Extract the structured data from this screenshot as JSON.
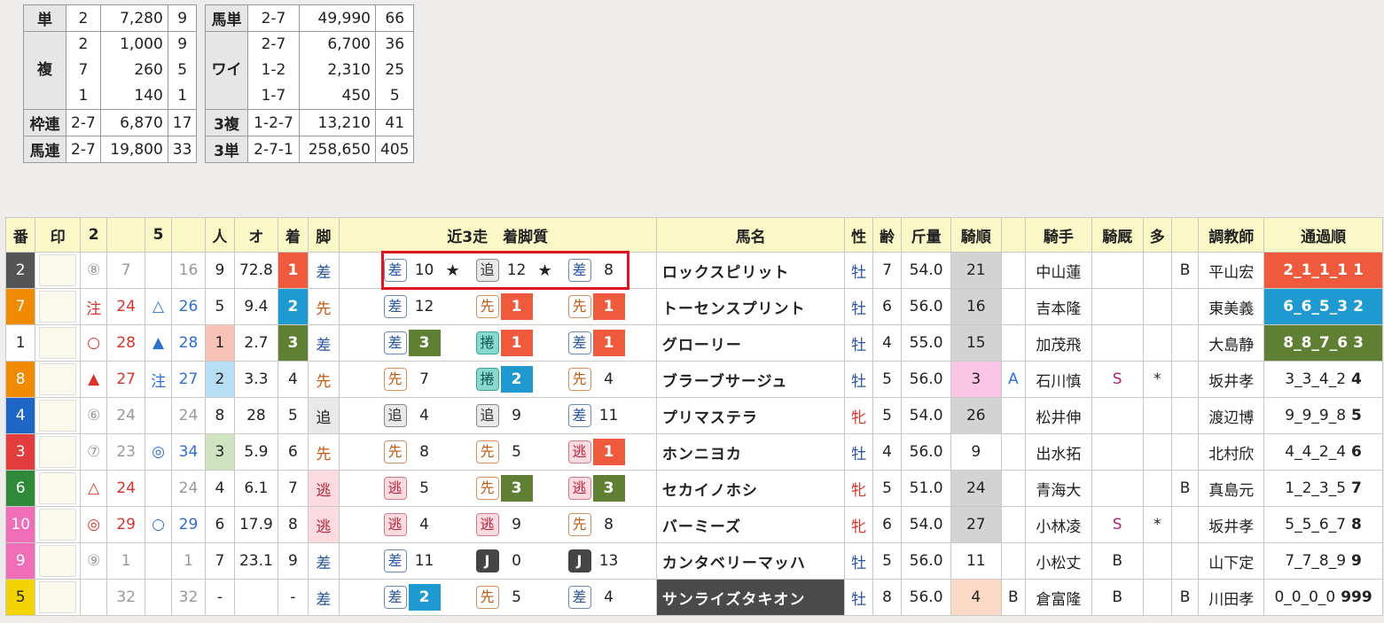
{
  "payout_left": {
    "tan": {
      "label": "単",
      "horse": "2",
      "amount": "7,280",
      "pop": "9"
    },
    "fuku": {
      "label": "複",
      "rows": [
        {
          "horse": "2",
          "amount": "1,000",
          "pop": "9"
        },
        {
          "horse": "7",
          "amount": "260",
          "pop": "5"
        },
        {
          "horse": "1",
          "amount": "140",
          "pop": "1"
        }
      ]
    },
    "wakuren": {
      "label": "枠連",
      "horse": "2-7",
      "amount": "6,870",
      "pop": "17"
    },
    "umaren": {
      "label": "馬連",
      "horse": "2-7",
      "amount": "19,800",
      "pop": "33"
    }
  },
  "payout_right": {
    "umatan": {
      "label": "馬単",
      "horse": "2-7",
      "amount": "49,990",
      "pop": "66"
    },
    "wide": {
      "label": "ワイ",
      "rows": [
        {
          "horse": "2-7",
          "amount": "6,700",
          "pop": "36"
        },
        {
          "horse": "1-2",
          "amount": "2,310",
          "pop": "25"
        },
        {
          "horse": "1-7",
          "amount": "450",
          "pop": "5"
        }
      ]
    },
    "sanfuku": {
      "label": "3複",
      "horse": "1-2-7",
      "amount": "13,210",
      "pop": "41"
    },
    "santan": {
      "label": "3単",
      "horse": "2-7-1",
      "amount": "258,650",
      "pop": "405"
    }
  },
  "headers": {
    "ban": "番",
    "shirushi": "印",
    "c2": "2",
    "c2b": "",
    "c5": "5",
    "c5b": "",
    "ninki": "人",
    "odds": "オ",
    "chaku": "着",
    "kyaku": "脚",
    "recent": "近3走　着脚質",
    "name": "馬名",
    "sex": "性",
    "age": "齢",
    "kinryo": "斤量",
    "kijun": "騎順",
    "k_blank": "",
    "jockey": "騎手",
    "kikyu": "騎厩",
    "ta": "多",
    "t_blank": "",
    "trainer": "調教師",
    "passing": "通過順"
  },
  "colors": {
    "frame": {
      "1": "#ffffff",
      "2": "#555555",
      "3": "#e23c3c",
      "4": "#1f66c6",
      "5": "#f3d400",
      "6": "#2f8a3a",
      "7": "#f08a00",
      "8": "#f08a00",
      "9": "#f06db8",
      "10": "#f06db8"
    },
    "place": {
      "1": "#f05a3c",
      "2": "#1f9ad0",
      "3": "#5f7f33"
    },
    "pop": {
      "1": "#f9c2b6",
      "2": "#b7def2",
      "3": "#cfe3c0"
    },
    "kijun_gray": "#d3d3d3",
    "kijun_pink": "#fbc6e6",
    "kijun_peach": "#fbd9c6",
    "pass": {
      "1": "#f05a3c",
      "2": "#1f9ad0",
      "3": "#5f7f33"
    }
  },
  "rows": [
    {
      "ban": "2",
      "frame": "2",
      "c2": "⑧",
      "c2v": "7",
      "c5": "",
      "c5v": "16",
      "ninki": "9",
      "odds": "72.8",
      "chaku": "1",
      "kyaku": "差",
      "recent": [
        {
          "s": "差",
          "p": "10",
          "star": "★"
        },
        {
          "s": "追",
          "p": "12",
          "star": "★"
        },
        {
          "s": "差",
          "p": "8",
          "star": ""
        }
      ],
      "name": "ロックスピリット",
      "sex": "牡",
      "age": "7",
      "kinryo": "54.0",
      "kijun": "21",
      "kb": "",
      "jockey": "中山蓮",
      "kikyu": "",
      "ta": "",
      "tb": "B",
      "trainer": "平山宏",
      "pass": "2_1_1_1",
      "passr": "1"
    },
    {
      "ban": "7",
      "frame": "7",
      "c2": "注",
      "c2v": "24",
      "c5": "△",
      "c5v": "26",
      "ninki": "5",
      "odds": "9.4",
      "chaku": "2",
      "kyaku": "先",
      "recent": [
        {
          "s": "差",
          "p": "12",
          "star": ""
        },
        {
          "s": "先",
          "p": "1",
          "star": ""
        },
        {
          "s": "先",
          "p": "1",
          "star": ""
        }
      ],
      "name": "トーセンスプリント",
      "sex": "牡",
      "age": "6",
      "kinryo": "56.0",
      "kijun": "16",
      "kb": "",
      "jockey": "吉本隆",
      "kikyu": "",
      "ta": "",
      "tb": "",
      "trainer": "東美義",
      "pass": "6_6_5_3",
      "passr": "2"
    },
    {
      "ban": "1",
      "frame": "1",
      "c2": "○",
      "c2v": "28",
      "c5": "▲",
      "c5v": "28",
      "ninki": "1",
      "odds": "2.7",
      "chaku": "3",
      "kyaku": "差",
      "recent": [
        {
          "s": "差",
          "p": "3",
          "star": ""
        },
        {
          "s": "捲",
          "p": "1",
          "star": ""
        },
        {
          "s": "差",
          "p": "1",
          "star": ""
        }
      ],
      "name": "グローリー",
      "sex": "牡",
      "age": "4",
      "kinryo": "55.0",
      "kijun": "15",
      "kb": "",
      "jockey": "加茂飛",
      "kikyu": "",
      "ta": "",
      "tb": "",
      "trainer": "大島静",
      "pass": "8_8_7_6",
      "passr": "3"
    },
    {
      "ban": "8",
      "frame": "8",
      "c2": "▲",
      "c2v": "27",
      "c5": "注",
      "c5v": "27",
      "ninki": "2",
      "odds": "3.3",
      "chaku": "4",
      "kyaku": "先",
      "recent": [
        {
          "s": "先",
          "p": "7",
          "star": ""
        },
        {
          "s": "捲",
          "p": "2",
          "star": ""
        },
        {
          "s": "先",
          "p": "4",
          "star": ""
        }
      ],
      "name": "ブラーブサージュ",
      "sex": "牡",
      "age": "5",
      "kinryo": "56.0",
      "kijun": "3",
      "kb": "A",
      "jockey": "石川慎",
      "kikyu": "S",
      "ta": "*",
      "tb": "",
      "trainer": "坂井孝",
      "pass": "3_3_4_2",
      "passr": "4"
    },
    {
      "ban": "4",
      "frame": "4",
      "c2": "⑥",
      "c2v": "24",
      "c5": "",
      "c5v": "24",
      "ninki": "8",
      "odds": "28",
      "chaku": "5",
      "kyaku": "追",
      "recent": [
        {
          "s": "追",
          "p": "4",
          "star": ""
        },
        {
          "s": "追",
          "p": "9",
          "star": ""
        },
        {
          "s": "差",
          "p": "11",
          "star": ""
        }
      ],
      "name": "プリマステラ",
      "sex": "牝",
      "age": "5",
      "kinryo": "54.0",
      "kijun": "26",
      "kb": "",
      "jockey": "松井伸",
      "kikyu": "",
      "ta": "",
      "tb": "",
      "trainer": "渡辺博",
      "pass": "9_9_9_8",
      "passr": "5"
    },
    {
      "ban": "3",
      "frame": "3",
      "c2": "⑦",
      "c2v": "23",
      "c5": "◎",
      "c5v": "34",
      "ninki": "3",
      "odds": "5.9",
      "chaku": "6",
      "kyaku": "先",
      "recent": [
        {
          "s": "先",
          "p": "8",
          "star": ""
        },
        {
          "s": "先",
          "p": "5",
          "star": ""
        },
        {
          "s": "逃",
          "p": "1",
          "star": ""
        }
      ],
      "name": "ホンニヨカ",
      "sex": "牡",
      "age": "4",
      "kinryo": "56.0",
      "kijun": "9",
      "kb": "",
      "jockey": "出水拓",
      "kikyu": "",
      "ta": "",
      "tb": "",
      "trainer": "北村欣",
      "pass": "4_4_2_4",
      "passr": "6"
    },
    {
      "ban": "6",
      "frame": "6",
      "c2": "△",
      "c2v": "24",
      "c5": "",
      "c5v": "24",
      "ninki": "4",
      "odds": "6.1",
      "chaku": "7",
      "kyaku": "逃",
      "recent": [
        {
          "s": "逃",
          "p": "5",
          "star": ""
        },
        {
          "s": "先",
          "p": "3",
          "star": ""
        },
        {
          "s": "逃",
          "p": "3",
          "star": ""
        }
      ],
      "name": "セカイノホシ",
      "sex": "牝",
      "age": "5",
      "kinryo": "51.0",
      "kijun": "24",
      "kb": "",
      "jockey": "青海大",
      "kikyu": "",
      "ta": "",
      "tb": "B",
      "trainer": "真島元",
      "pass": "1_2_3_5",
      "passr": "7"
    },
    {
      "ban": "10",
      "frame": "10",
      "c2": "◎",
      "c2v": "29",
      "c5": "○",
      "c5v": "29",
      "ninki": "6",
      "odds": "17.9",
      "chaku": "8",
      "kyaku": "逃",
      "recent": [
        {
          "s": "逃",
          "p": "4",
          "star": ""
        },
        {
          "s": "逃",
          "p": "9",
          "star": ""
        },
        {
          "s": "先",
          "p": "8",
          "star": ""
        }
      ],
      "name": "バーミーズ",
      "sex": "牝",
      "age": "6",
      "kinryo": "54.0",
      "kijun": "27",
      "kb": "",
      "jockey": "小林凌",
      "kikyu": "S",
      "ta": "*",
      "tb": "",
      "trainer": "坂井孝",
      "pass": "5_5_6_7",
      "passr": "8"
    },
    {
      "ban": "9",
      "frame": "9",
      "c2": "⑨",
      "c2v": "1",
      "c5": "",
      "c5v": "1",
      "ninki": "7",
      "odds": "23.1",
      "chaku": "9",
      "kyaku": "差",
      "recent": [
        {
          "s": "差",
          "p": "11",
          "star": ""
        },
        {
          "s": "J",
          "p": "0",
          "star": ""
        },
        {
          "s": "J",
          "p": "13",
          "star": ""
        }
      ],
      "name": "カンタベリーマッハ",
      "sex": "牡",
      "age": "5",
      "kinryo": "56.0",
      "kijun": "11",
      "kb": "",
      "jockey": "小松丈",
      "kikyu": "B",
      "ta": "",
      "tb": "",
      "trainer": "山下定",
      "pass": "7_7_8_9",
      "passr": "9"
    },
    {
      "ban": "5",
      "frame": "5",
      "c2": "",
      "c2v": "32",
      "c5": "",
      "c5v": "32",
      "ninki": "-",
      "odds": "",
      "chaku": "-",
      "kyaku": "差",
      "recent": [
        {
          "s": "差",
          "p": "2",
          "star": ""
        },
        {
          "s": "先",
          "p": "5",
          "star": ""
        },
        {
          "s": "差",
          "p": "4",
          "star": ""
        }
      ],
      "name": "サンライズタキオン",
      "sex": "牡",
      "age": "8",
      "kinryo": "56.0",
      "kijun": "4",
      "kb": "B",
      "jockey": "倉富隆",
      "kikyu": "B",
      "ta": "",
      "tb": "B",
      "trainer": "川田孝",
      "pass": "0_0_0_0",
      "passr": "999"
    }
  ]
}
